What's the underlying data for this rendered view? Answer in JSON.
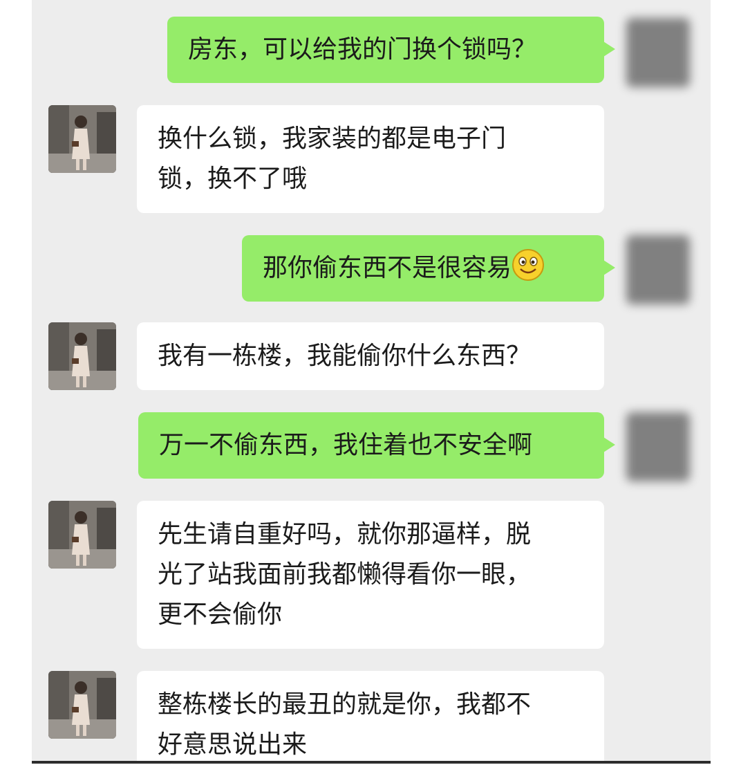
{
  "colors": {
    "background": "#ededed",
    "outgoing_bubble": "#95ec69",
    "incoming_bubble": "#ffffff",
    "text": "#1b1b1b"
  },
  "messages": [
    {
      "sender": "me",
      "text": "房东，可以给我的门换个锁吗？"
    },
    {
      "sender": "landlord",
      "lines": [
        "换什么锁，我家装的都是电子门",
        "锁，换不了哦"
      ]
    },
    {
      "sender": "me",
      "text": "那你偷东西不是很容易",
      "emoji": "smile-emoji-icon"
    },
    {
      "sender": "landlord",
      "text": "我有一栋楼，我能偷你什么东西？"
    },
    {
      "sender": "me",
      "text": "万一不偷东西，我住着也不安全啊"
    },
    {
      "sender": "landlord",
      "lines": [
        "先生请自重好吗，就你那逼样，脱",
        "光了站我面前我都懒得看你一眼，",
        "更不会偷你"
      ]
    },
    {
      "sender": "landlord",
      "lines": [
        "整栋楼长的最丑的就是你，我都不",
        "好意思说出来"
      ]
    }
  ]
}
